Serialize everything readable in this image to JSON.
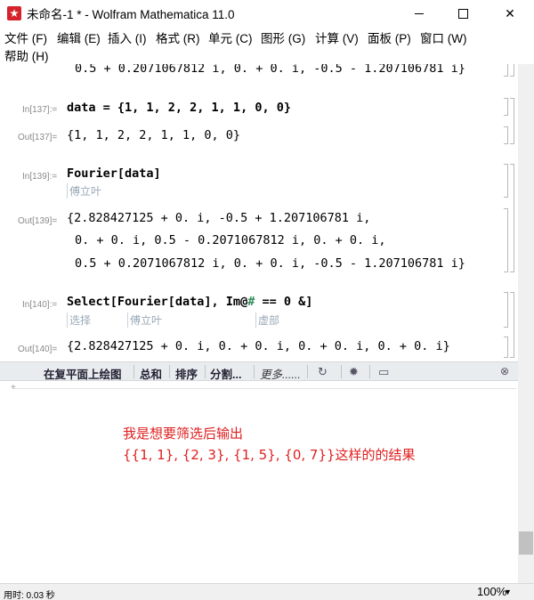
{
  "window": {
    "title": "未命名-1 * - Wolfram Mathematica 11.0",
    "app_icon": "mathematica-icon"
  },
  "menu": [
    "文件 (F)",
    "编辑 (E)",
    "插入 (I)",
    "格式 (R)",
    "单元 (C)",
    "图形 (G)",
    "计算 (V)",
    "面板 (P)",
    "窗口 (W)",
    "帮助 (H)"
  ],
  "cells": {
    "top_output_line": "0.5 + 0.2071067812 i, 0. + 0. i, -0.5 - 1.207106781 i}",
    "in137": {
      "label": "In[137]:=",
      "code": "data = {1, 1, 2, 2, 1, 1, 0, 0}"
    },
    "out137": {
      "label": "Out[137]=",
      "value": "{1, 1, 2, 2, 1, 1, 0, 0}"
    },
    "in139": {
      "label": "In[139]:=",
      "code": "Fourier[data]",
      "hint": "傅立叶"
    },
    "out139": {
      "label": "Out[139]=",
      "line1": "{2.828427125 + 0. i, -0.5 + 1.207106781 i,",
      "line2": "0. + 0. i, 0.5 - 0.2071067812 i, 0. + 0. i,",
      "line3": "0.5 + 0.2071067812 i, 0. + 0. i, -0.5 - 1.207106781 i}"
    },
    "in140": {
      "label": "In[140]:=",
      "code_prefix": "Select[Fourier[data], Im@",
      "code_slot": "#",
      "code_suffix": " == 0 &]",
      "hint1": "选择",
      "hint2": "傅立叶",
      "hint3": "虚部"
    },
    "out140": {
      "label": "Out[140]=",
      "value": "{2.828427125 + 0. i, 0. + 0. i, 0. + 0. i, 0. + 0. i}"
    }
  },
  "suggestions": {
    "items": [
      "在复平面上绘图",
      "总和",
      "排序",
      "分割...",
      "更多......"
    ],
    "icons": [
      "loop-icon",
      "gear-icon",
      "chat-icon",
      "close-icon"
    ]
  },
  "note": {
    "line1": "我是想要筛选后输出",
    "line2": "{{1, 1}, {2, 3}, {1, 5}, {0, 7}}这样的的结果"
  },
  "status": {
    "timing": "用时: 0.03 秒",
    "zoom": "100%"
  }
}
